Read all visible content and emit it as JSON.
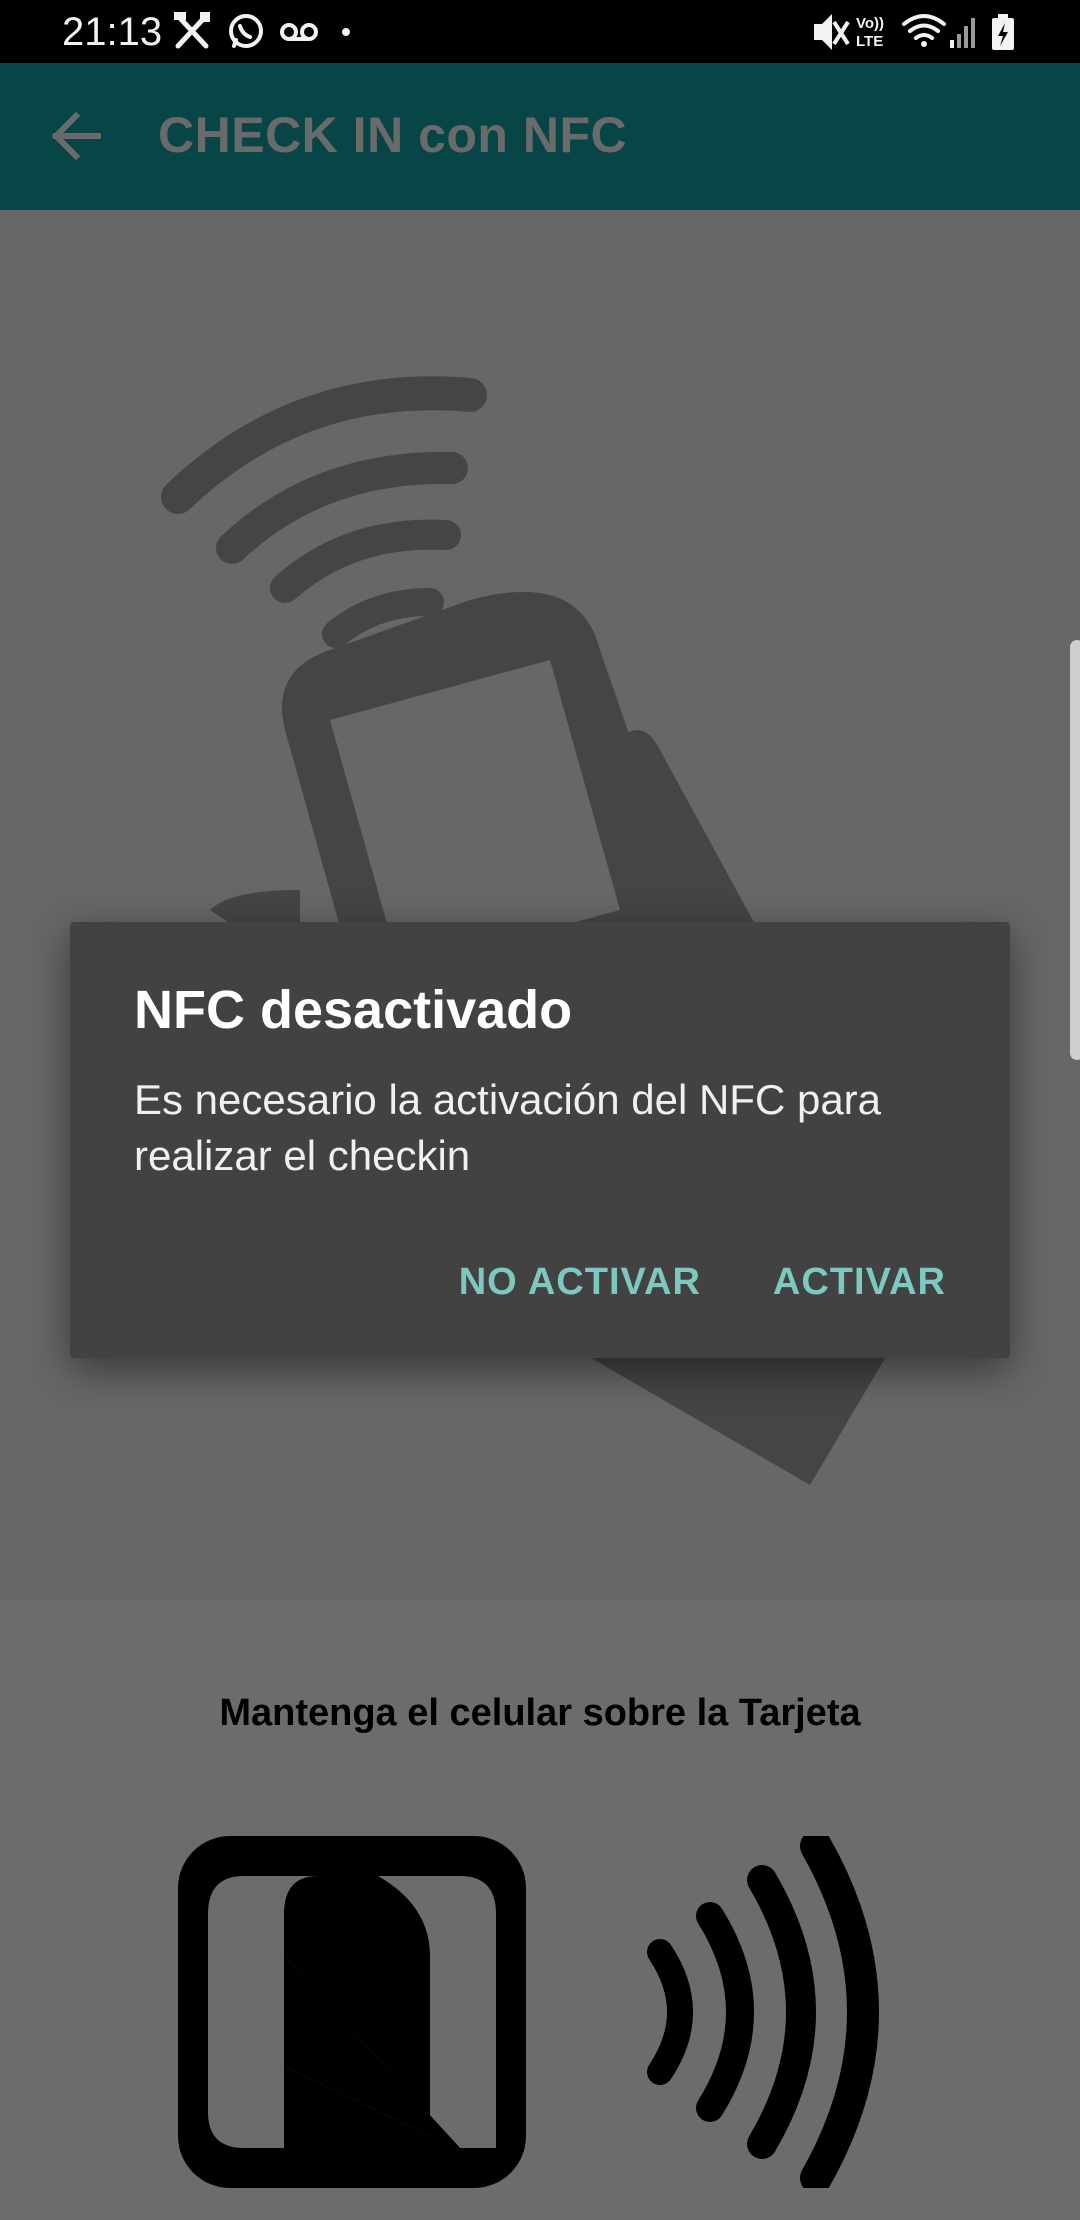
{
  "status_bar": {
    "time": "21:13",
    "left_icons": [
      "tools-icon",
      "whatsapp-icon",
      "voicemail-icon",
      "dot-icon"
    ],
    "right_icons": [
      "mute-icon",
      "volte-icon",
      "wifi-icon",
      "signal-icon",
      "battery-charging-icon"
    ],
    "volte_label_top": "Vo))",
    "volte_label_bottom": "LTE"
  },
  "app_bar": {
    "title": "CHECK IN con NFC",
    "color": "#0f8b8d"
  },
  "content": {
    "instruction": "Mantenga el celular sobre la Tarjeta"
  },
  "dialog": {
    "title": "NFC desactivado",
    "message": "Es necesario la activación del NFC para realizar el checkin",
    "negative_button": "NO ACTIVAR",
    "positive_button": "ACTIVAR",
    "accent_color": "#7ec8c2"
  }
}
